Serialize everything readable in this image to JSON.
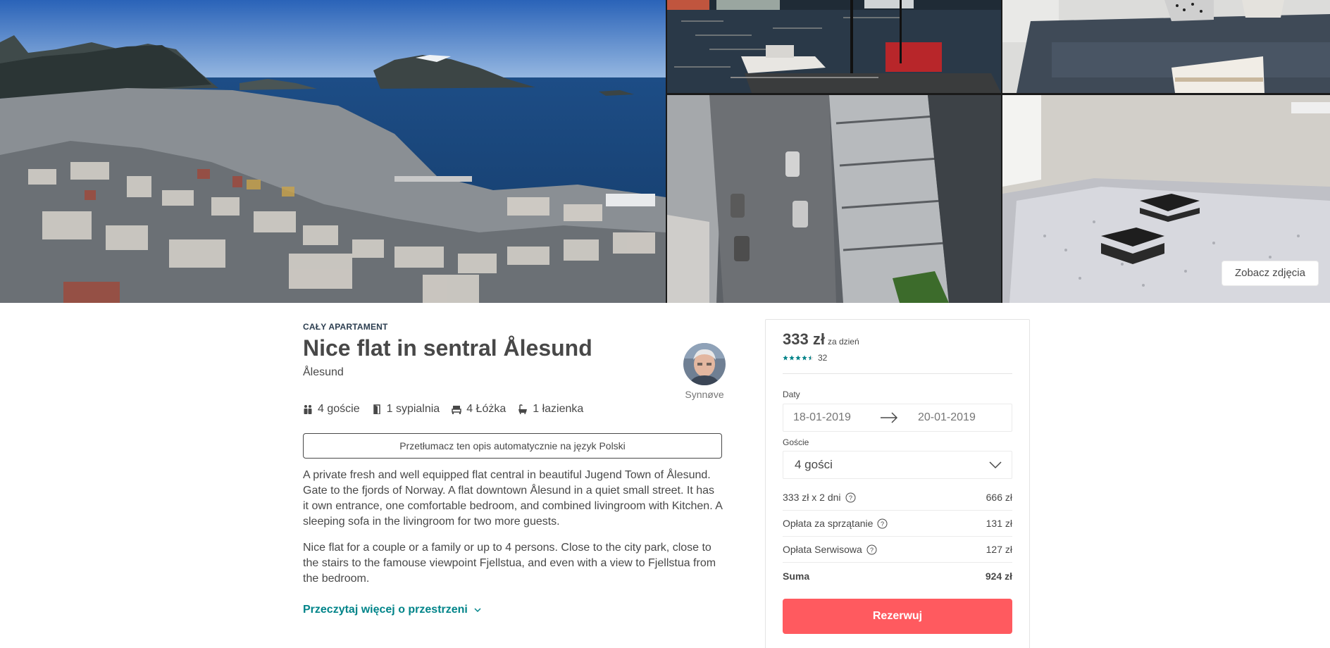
{
  "gallery": {
    "photos": [
      {
        "name": "aalesund-panorama"
      },
      {
        "name": "harbor-boats"
      },
      {
        "name": "living-room-sofa"
      },
      {
        "name": "aerial-street"
      },
      {
        "name": "bedroom"
      }
    ],
    "see_photos_label": "Zobacz zdjęcia"
  },
  "listing": {
    "type": "CAŁY APARTAMENT",
    "title": "Nice flat in sentral Ålesund",
    "location": "Ålesund",
    "host_name": "Synnøve",
    "amenities": {
      "guests": "4 goście",
      "bedrooms": "1 sypialnia",
      "beds": "4 Łóżka",
      "bathrooms": "1 łazienka"
    },
    "translate_label": "Przetłumacz ten opis automatycznie na język Polski",
    "description": {
      "paragraph1": "A private fresh and well equipped flat central in beautiful Jugend Town of Ålesund. Gate to the fjords of Norway. A flat downtown Ålesund in a quiet small street. It has it own entrance, one comfortable bedroom, and combined livingroom with Kitchen. A sleeping sofa in the livingroom for two more guests.",
      "paragraph2": "Nice flat for a couple or a family or up to 4 persons. Close to the city park, close to the stairs to the famouse viewpoint Fjellstua, and even with a view to Fjellstua from the bedroom."
    },
    "read_more_label": "Przeczytaj więcej o przestrzeni"
  },
  "booking": {
    "price": "333 zł",
    "price_unit": "za dzień",
    "rating_value": 4.5,
    "rating_max": 5,
    "review_count": "32",
    "dates_label": "Daty",
    "checkin": "18-01-2019",
    "checkout": "20-01-2019",
    "guests_label": "Goście",
    "guests_value": "4 gości",
    "fees": {
      "nights_label": "333 zł x 2 dni",
      "nights_amount": "666 zł",
      "cleaning_label": "Opłata za sprzątanie",
      "cleaning_amount": "131 zł",
      "service_label": "Opłata Serwisowa",
      "service_amount": "127 zł",
      "total_label": "Suma",
      "total_amount": "924 zł"
    },
    "reserve_label": "Rezerwuj"
  },
  "colors": {
    "accent": "#ff5a5f",
    "link": "#008489",
    "star": "#008489",
    "text": "#484848"
  }
}
